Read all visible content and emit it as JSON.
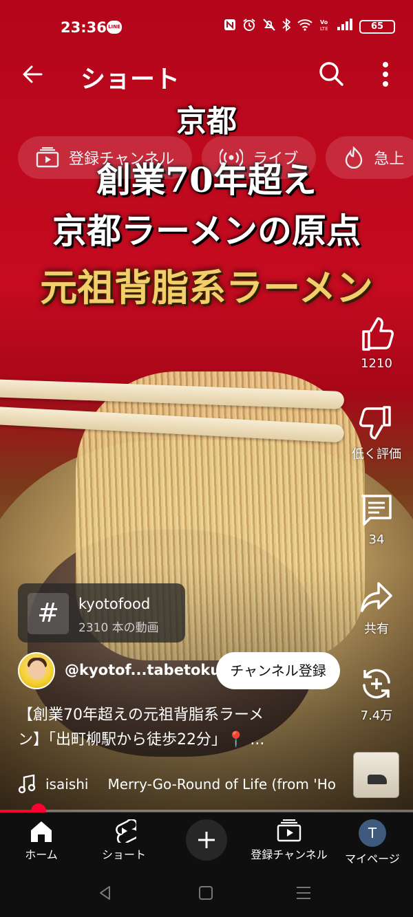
{
  "status_bar": {
    "time": "23:36",
    "line_app": "LINE",
    "battery": "65"
  },
  "app_bar": {
    "title": "ショート"
  },
  "chips": [
    {
      "label": "登録チャンネル",
      "icon": "subscriptions-icon"
    },
    {
      "label": "ライブ",
      "icon": "live-icon"
    },
    {
      "label": "急上",
      "icon": "trending-icon"
    }
  ],
  "video_overlay": {
    "line_top": "京都",
    "line_1": "創業70年超え",
    "line_2": "京都ラーメンの原点",
    "line_3": "元祖背脂系ラーメン"
  },
  "actions": {
    "like_count": "1210",
    "dislike_label": "低く評価",
    "comment_count": "34",
    "share_label": "共有",
    "remix_count": "7.4万"
  },
  "hashtag": {
    "symbol": "#",
    "name": "kyotofood",
    "video_count": "2310 本の動画"
  },
  "channel": {
    "handle": "@kyotof...tabetoku",
    "subscribe_label": "チャンネル登録"
  },
  "description": {
    "line_1": "【創業70年超えの元祖背脂系ラーメ",
    "line_2": "ン】「出町柳駅から徒歩22分」📍 ..."
  },
  "music": {
    "artist": "isaishi",
    "song": "Merry-Go-Round of Life (from 'Ho"
  },
  "progress": {
    "fraction": 0.093
  },
  "bottom_nav": {
    "home": "ホーム",
    "shorts": "ショート",
    "create": "+",
    "subscriptions": "登録チャンネル",
    "profile_initial": "T",
    "my_page": "マイページ"
  },
  "colors": {
    "accent_red": "#ff0033",
    "background_red": "#c60b20",
    "nav_background": "#0f0f0f"
  }
}
